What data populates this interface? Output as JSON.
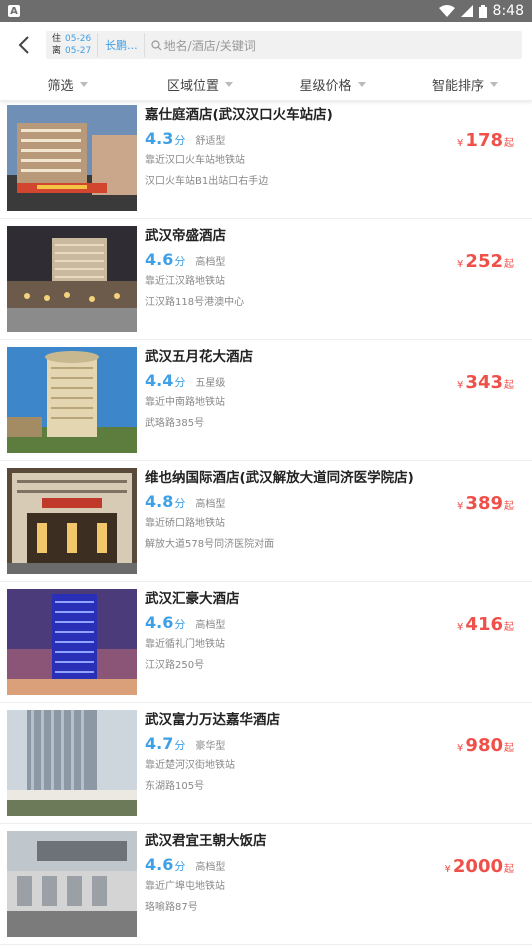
{
  "statusbar": {
    "app_icon": "A",
    "time": "8:48"
  },
  "search": {
    "checkin_label": "住",
    "checkin_date": "05-26",
    "checkout_label": "离",
    "checkout_date": "05-27",
    "city": "长鹏...",
    "placeholder": "地名/酒店/关键词"
  },
  "filters": [
    "筛选",
    "区域位置",
    "星级价格",
    "智能排序"
  ],
  "currency_symbol": "¥",
  "price_suffix": "起",
  "score_unit": "分",
  "hotels": [
    {
      "name": "嘉仕庭酒店(武汉汉口火车站店)",
      "score": "4.3",
      "level": "舒适型",
      "near": "靠近汉口火车站地铁站",
      "address": "汉口火车站B1出站口右手边",
      "price": "178"
    },
    {
      "name": "武汉帝盛酒店",
      "score": "4.6",
      "level": "高档型",
      "near": "靠近江汉路地铁站",
      "address": "江汉路118号港澳中心",
      "price": "252"
    },
    {
      "name": "武汉五月花大酒店",
      "score": "4.4",
      "level": "五星级",
      "near": "靠近中南路地铁站",
      "address": "武珞路385号",
      "price": "343"
    },
    {
      "name": "维也纳国际酒店(武汉解放大道同济医学院店)",
      "score": "4.8",
      "level": "高档型",
      "near": "靠近硚口路地铁站",
      "address": "解放大道578号同济医院对面",
      "price": "389"
    },
    {
      "name": "武汉汇豪大酒店",
      "score": "4.6",
      "level": "高档型",
      "near": "靠近循礼门地铁站",
      "address": "江汉路250号",
      "price": "416"
    },
    {
      "name": "武汉富力万达嘉华酒店",
      "score": "4.7",
      "level": "豪华型",
      "near": "靠近楚河汉街地铁站",
      "address": "东湖路105号",
      "price": "980"
    },
    {
      "name": "武汉君宜王朝大饭店",
      "score": "4.6",
      "level": "高档型",
      "near": "靠近广埠屯地铁站",
      "address": "珞喻路87号",
      "price": "2000"
    }
  ]
}
